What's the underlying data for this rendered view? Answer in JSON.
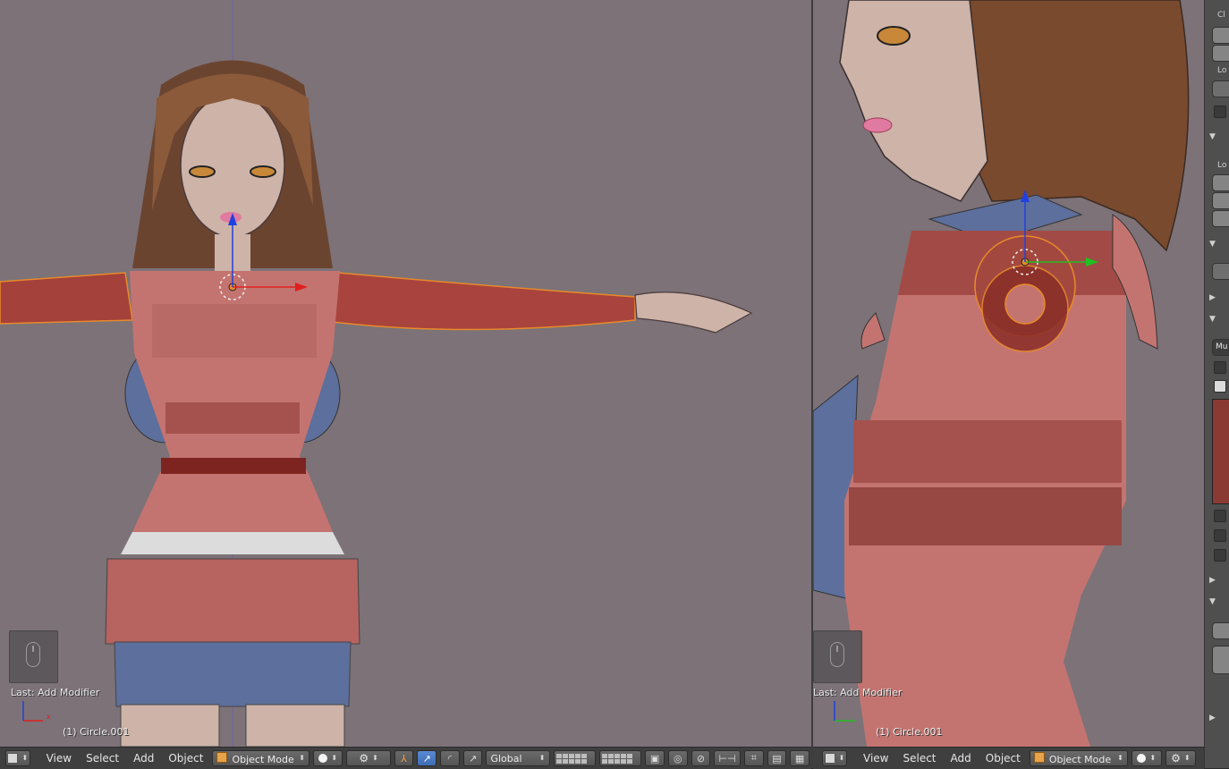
{
  "viewports": {
    "front": {
      "last_operator": "Last: Add Modifier",
      "object_name": "(1) Circle.001"
    },
    "side": {
      "last_operator": "Last: Add Modifier",
      "object_name": "(1) Circle.001"
    }
  },
  "header_front": {
    "menus": [
      "View",
      "Select",
      "Add",
      "Object"
    ],
    "mode": "Object Mode",
    "orientation": "Global"
  },
  "header_side": {
    "menus": [
      "View",
      "Select",
      "Add",
      "Object"
    ],
    "mode": "Object Mode"
  },
  "properties_panel": {
    "visible_fragments": [
      "Cl",
      "Lo",
      "Lo",
      "Mu"
    ]
  },
  "colors": {
    "viewport_bg": "#7c7278",
    "header_bg": "#3f3f3f",
    "selection_outline": "#e88a2a",
    "axis_x": "#e02020",
    "axis_y": "#20c020",
    "axis_z": "#2040e0"
  }
}
